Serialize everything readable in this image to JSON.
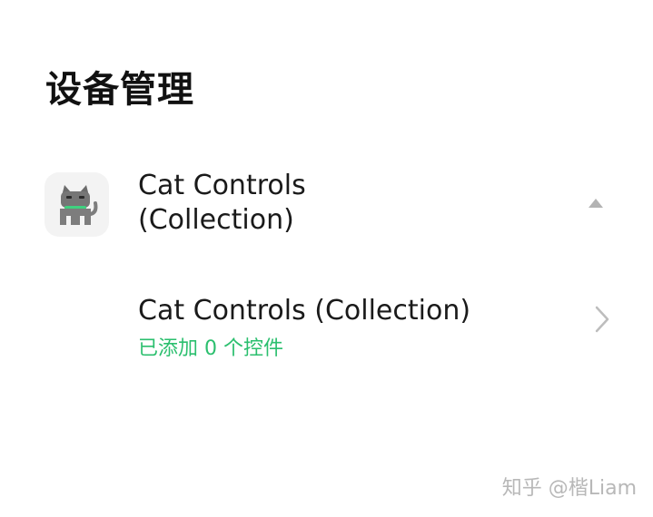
{
  "header": {
    "title": "设备管理"
  },
  "app": {
    "name_line1": "Cat Controls",
    "name_line2": "(Collection)",
    "icon": "cat-icon",
    "expanded": true
  },
  "collection": {
    "title": "Cat Controls (Collection)",
    "status": "已添加 0 个控件"
  },
  "watermark": {
    "text": "知乎 @楷Liam"
  },
  "colors": {
    "accent_green": "#2bbf6e",
    "text_primary": "#1a1a1a",
    "icon_gray": "#b8b8b8"
  }
}
